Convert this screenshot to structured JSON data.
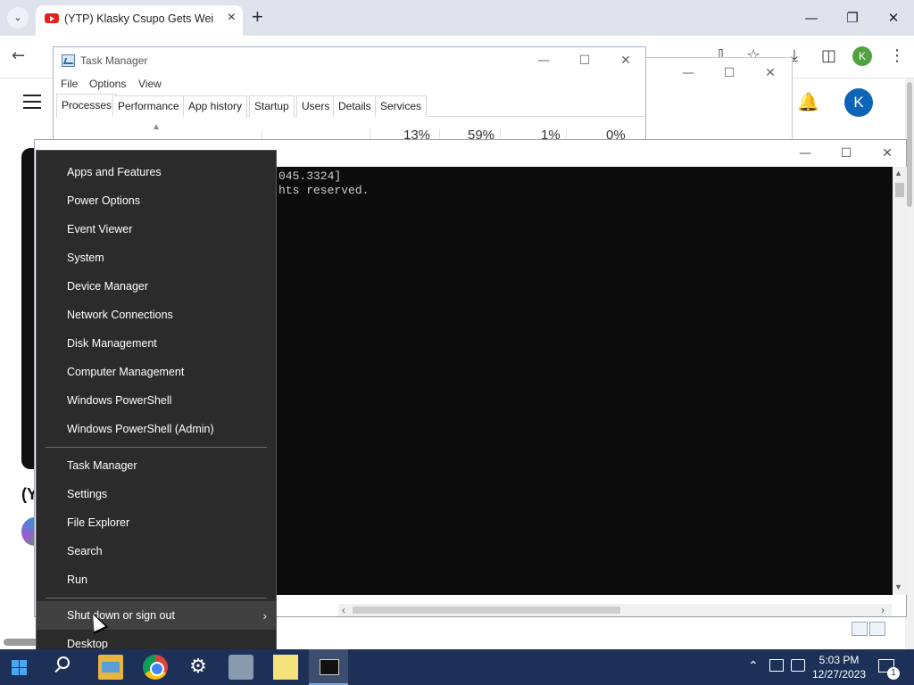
{
  "chrome": {
    "tab_title": "(YTP) Klasky Csupo Gets Weirder",
    "profile_initial": "K",
    "youtube": {
      "avatar_initial": "K",
      "video_title_fragment": "(Y"
    }
  },
  "task_manager": {
    "title": "Task Manager",
    "menu": [
      "File",
      "Options",
      "View"
    ],
    "tabs": [
      "Processes",
      "Performance",
      "App history",
      "Startup",
      "Users",
      "Details",
      "Services"
    ],
    "active_tab": "Processes",
    "column_values": [
      "13%",
      "59%",
      "1%",
      "0%"
    ]
  },
  "cmd": {
    "lines": [
      "045.3324]",
      "hts reserved."
    ]
  },
  "winx_menu": {
    "group1": [
      "Apps and Features",
      "Power Options",
      "Event Viewer",
      "System",
      "Device Manager",
      "Network Connections",
      "Disk Management",
      "Computer Management",
      "Windows PowerShell",
      "Windows PowerShell (Admin)"
    ],
    "group2": [
      "Task Manager",
      "Settings",
      "File Explorer",
      "Search",
      "Run"
    ],
    "group3": [
      "Shut down or sign out",
      "Desktop"
    ],
    "hovered_item": "Shut down or sign out"
  },
  "taskbar": {
    "time": "5:03 PM",
    "date": "12/27/2023",
    "notification_count": "1"
  },
  "colors": {
    "menu_bg": "#2b2b2b",
    "menu_hover": "#414141",
    "taskbar_bg": "#1d3158",
    "console_bg": "#0c0c0c"
  }
}
